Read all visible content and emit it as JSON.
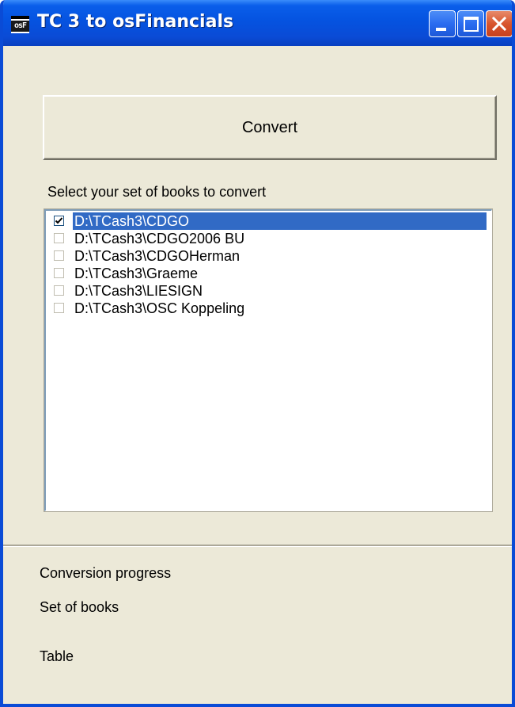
{
  "window": {
    "title": "TC 3 to osFinancials",
    "icon_text": "osF",
    "controls": [
      "minimize-icon",
      "maximize-icon",
      "close-icon"
    ]
  },
  "main": {
    "convert_label": "Convert",
    "select_label": "Select your set of books to convert",
    "books": [
      {
        "path": "D:\\TCash3\\CDGO",
        "checked": true,
        "selected": true
      },
      {
        "path": "D:\\TCash3\\CDGO2006 BU",
        "checked": false,
        "selected": false
      },
      {
        "path": "D:\\TCash3\\CDGOHerman",
        "checked": false,
        "selected": false
      },
      {
        "path": "D:\\TCash3\\Graeme",
        "checked": false,
        "selected": false
      },
      {
        "path": "D:\\TCash3\\LIESIGN",
        "checked": false,
        "selected": false
      },
      {
        "path": "D:\\TCash3\\OSC Koppeling",
        "checked": false,
        "selected": false
      }
    ]
  },
  "status": {
    "progress_label": "Conversion progress",
    "set_of_books_label": "Set of books",
    "table_label": "Table"
  },
  "colors": {
    "titlebar": "#0A4BD6",
    "selection": "#316AC5",
    "face": "#ECE9D8"
  }
}
